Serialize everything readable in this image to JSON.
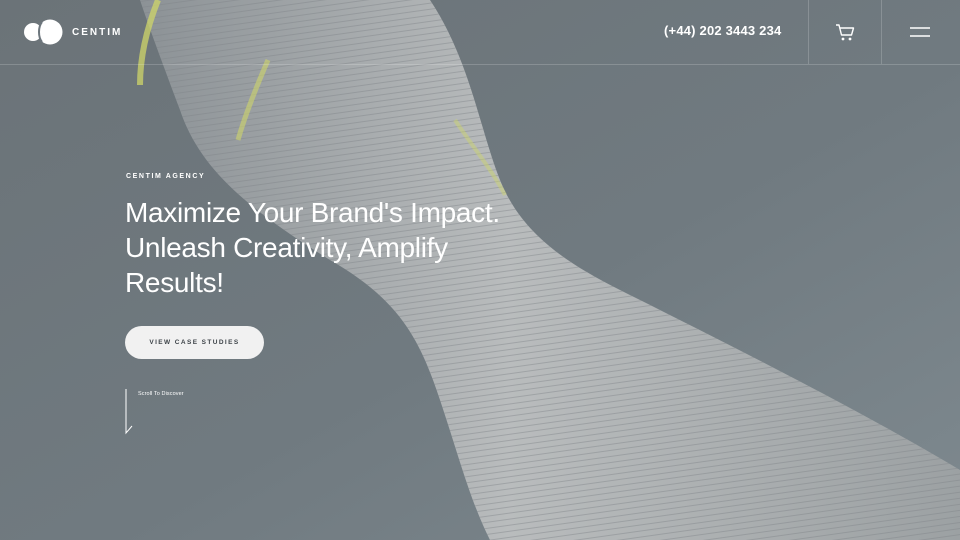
{
  "header": {
    "logo_text": "CENTIM",
    "phone": "(+44) 202 3443 234",
    "cart_icon": "cart-icon",
    "menu_icon": "hamburger-menu-icon"
  },
  "hero": {
    "eyebrow": "CENTIM AGENCY",
    "headline_lines": [
      "Maximize Your Brand's Impact.",
      "Unleash Creativity, Amplify",
      "Results!"
    ],
    "cta_label": "VIEW CASE STUDIES",
    "scroll_label": "Scroll To Discover"
  },
  "colors": {
    "background": "#6d767d",
    "accent_stripe": "#d7e05a",
    "button_bg": "#f1f1f1",
    "button_text": "#3e4449"
  }
}
